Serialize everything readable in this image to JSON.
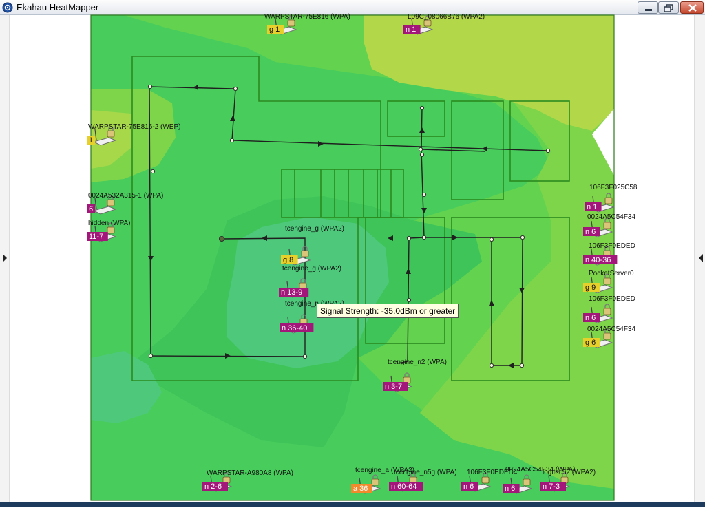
{
  "window": {
    "title": "Ekahau HeatMapper",
    "controls": [
      "minimize",
      "maximize",
      "close"
    ],
    "left_pane_arrow_icon": "triangle-right-icon",
    "right_pane_arrow_icon": "triangle-left-icon"
  },
  "heatmap": {
    "colors": {
      "strongest": "#4ec97c",
      "strong": "#48cc5c",
      "medium": "#5fd251",
      "weak": "#8fd54a",
      "weakest": "#b5d84a",
      "no_signal": "#ffffff",
      "floorplan_lines": "#2b8a1f",
      "survey_path": "#222222"
    }
  },
  "tooltip": {
    "text": "Signal Strength: -35.0dBm or greater"
  },
  "access_points": [
    {
      "name": "WARPSTAR-75E816 (WPA)",
      "badge": "g 1",
      "badge_color": "#e8d02a",
      "icon": "router-lock-icon"
    },
    {
      "name": "L09C_08066B76 (WPA2)",
      "badge": "n 1",
      "badge_color": "#a3167a",
      "icon": "router-lock-icon"
    },
    {
      "name": "WARPSTAR-75E816-2 (WEP)",
      "badge": "1",
      "badge_color": "#e8d02a",
      "icon": "router-lock-icon"
    },
    {
      "name": "0024A532A315-1 (WPA)",
      "badge": "6",
      "badge_color": "#a3167a",
      "icon": "router-lock-icon"
    },
    {
      "name": "hidden (WPA)",
      "badge": "11-7",
      "badge_color": "#a3167a",
      "icon": "router-lock-icon"
    },
    {
      "name": "tcengine_g (WPA2)",
      "badge": "g 8",
      "badge_color": "#e8d02a",
      "icon": "router-lock-icon"
    },
    {
      "name": "tcengine_g (WPA2)",
      "badge": "n 13-9",
      "badge_color": "#a3167a",
      "icon": "router-lock-icon"
    },
    {
      "name": "tcengine_n (WPA2)",
      "badge": "n 36-40",
      "badge_color": "#a3167a",
      "icon": "router-lock-icon"
    },
    {
      "name": "tcengine_n2 (WPA)",
      "badge": "n 3-7",
      "badge_color": "#a3167a",
      "icon": "router-lock-icon"
    },
    {
      "name": "106F3F025C58",
      "badge": "n 1",
      "badge_color": "#a3167a",
      "icon": "router-lock-icon"
    },
    {
      "name": "0024A5C54F34",
      "badge": "n 6",
      "badge_color": "#a3167a",
      "icon": "router-lock-icon"
    },
    {
      "name": "106F3F0EDED",
      "badge": "n 40-36",
      "badge_color": "#a3167a",
      "icon": "router-lock-icon"
    },
    {
      "name": "PocketServer0",
      "badge": "g 9",
      "badge_color": "#e8d02a",
      "icon": "router-lock-icon"
    },
    {
      "name": "106F3F0EDED",
      "badge": "n 6",
      "badge_color": "#a3167a",
      "icon": "router-lock-icon"
    },
    {
      "name": "0024A5C54F34",
      "badge": "g 6",
      "badge_color": "#e8d02a",
      "icon": "router-lock-icon"
    },
    {
      "name": "WARPSTAR-A980A8 (WPA)",
      "badge": "n 2-6",
      "badge_color": "#a3167a",
      "icon": "router-lock-icon"
    },
    {
      "name": "tcengine_a (WPA2)",
      "badge": "a 36",
      "badge_color": "#f28a2c",
      "icon": "router-lock-icon"
    },
    {
      "name": "tcengine_n5g (WPA)",
      "badge": "n 60-64",
      "badge_color": "#a3167a",
      "icon": "router-lock-icon"
    },
    {
      "name": "106F3F0EDED4",
      "badge": "n 6",
      "badge_color": "#a3167a",
      "icon": "router-lock-icon"
    },
    {
      "name": "0024A5C54F34 (WPA)",
      "badge": "n 6",
      "badge_color": "#a3167a",
      "icon": "router-lock-icon"
    },
    {
      "name": "logitec52 (WPA2)",
      "badge": "n 7-3",
      "badge_color": "#a3167a",
      "icon": "router-lock-icon"
    }
  ]
}
